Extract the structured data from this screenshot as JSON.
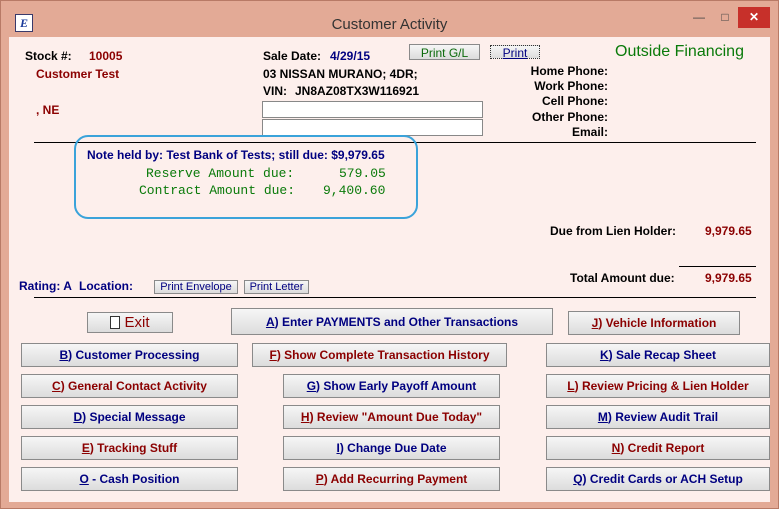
{
  "window": {
    "title": "Customer Activity",
    "app_icon": "E",
    "min": "—",
    "max": "□",
    "close": "✕"
  },
  "header": {
    "stock_label": "Stock #:",
    "stock_value": "10005",
    "customer_name": "Customer Test",
    "city_state": ", NE",
    "sale_date_label": "Sale Date:",
    "sale_date_value": "4/29/15",
    "vehicle": "03 NISSAN MURANO; 4DR;",
    "vin_label": "VIN:",
    "vin_value": "JN8AZ08TX3W116921",
    "print_gl": "Print G/L",
    "print": "Print",
    "financing": "Outside Financing",
    "home_phone": "Home Phone:",
    "work_phone": "Work Phone:",
    "cell_phone": "Cell Phone:",
    "other_phone": "Other Phone:",
    "email": "Email:"
  },
  "note": {
    "held_by": "Note held by: Test Bank of Tests; still due: $9,979.65",
    "reserve_label": "Reserve Amount due:",
    "reserve_value": "579.05",
    "contract_label": "Contract Amount due:",
    "contract_value": "9,400.60"
  },
  "totals": {
    "lien_label": "Due from Lien Holder:",
    "lien_value": "9,979.65",
    "total_label": "Total Amount due:",
    "total_value": "9,979.65"
  },
  "rating": {
    "label": "Rating: A",
    "location": "Location:",
    "print_envelope": "Print Envelope",
    "print_letter": "Print Letter"
  },
  "buttons": {
    "exit": "Exit",
    "a": {
      "key": "A",
      "rest": ") Enter PAYMENTS and Other Transactions"
    },
    "j": {
      "key": "J",
      "rest": ") Vehicle Information"
    },
    "b": {
      "key": "B",
      "rest": ") Customer Processing"
    },
    "f": {
      "key": "F",
      "rest": ") Show Complete Transaction History"
    },
    "k": {
      "key": "K",
      "rest": ") Sale Recap Sheet"
    },
    "c": {
      "key": "C",
      "rest": ") General Contact Activity"
    },
    "g": {
      "key": "G",
      "rest": ") Show Early Payoff Amount"
    },
    "l": {
      "key": "L",
      "rest": ") Review Pricing & Lien Holder"
    },
    "d": {
      "key": "D",
      "rest": ") Special Message"
    },
    "h": {
      "key": "H",
      "rest": ") Review \"Amount Due Today\""
    },
    "m": {
      "key": "M",
      "rest": ") Review Audit Trail"
    },
    "e": {
      "key": "E",
      "rest": ") Tracking Stuff"
    },
    "i": {
      "key": "I",
      "rest": ") Change Due Date"
    },
    "n": {
      "key": "N",
      "rest": ") Credit Report"
    },
    "o": {
      "key": "O",
      "rest": " - Cash Position"
    },
    "p": {
      "key": "P",
      "rest": ") Add Recurring Payment"
    },
    "q": {
      "key": "Q",
      "rest": ") Credit Cards or ACH Setup"
    }
  },
  "colors": {
    "frame": "#e3aa96",
    "client": "#fdefec",
    "close": "#c7302a",
    "note_border": "#3aa3da"
  }
}
